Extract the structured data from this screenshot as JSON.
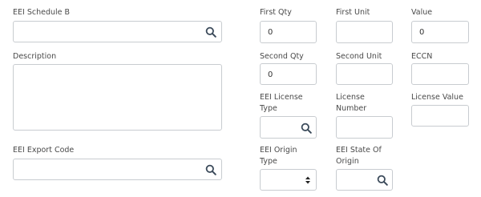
{
  "fields": {
    "eei_schedule_b": {
      "label": "EEI Schedule B",
      "value": ""
    },
    "description": {
      "label": "Description",
      "value": ""
    },
    "eei_export_code": {
      "label": "EEI Export Code",
      "value": ""
    },
    "first_qty": {
      "label": "First Qty",
      "value": "0"
    },
    "first_unit": {
      "label": "First Unit",
      "value": ""
    },
    "value": {
      "label": "Value",
      "value": "0"
    },
    "second_qty": {
      "label": "Second Qty",
      "value": "0"
    },
    "second_unit": {
      "label": "Second Unit",
      "value": ""
    },
    "eccn": {
      "label": "ECCN",
      "value": ""
    },
    "eei_license_type": {
      "label_line1": "EEI License",
      "label_line2": "Type",
      "value": ""
    },
    "license_number": {
      "label_line1": "License",
      "label_line2": "Number",
      "value": ""
    },
    "license_value": {
      "label": "License Value",
      "value": ""
    },
    "eei_origin_type": {
      "label_line1": "EEI Origin",
      "label_line2": "Type",
      "value": ""
    },
    "eei_state_of_origin": {
      "label_line1": "EEI State Of",
      "label_line2": "Origin",
      "value": ""
    }
  },
  "icons": {
    "search": "search-icon",
    "select": "select-arrows-icon"
  }
}
